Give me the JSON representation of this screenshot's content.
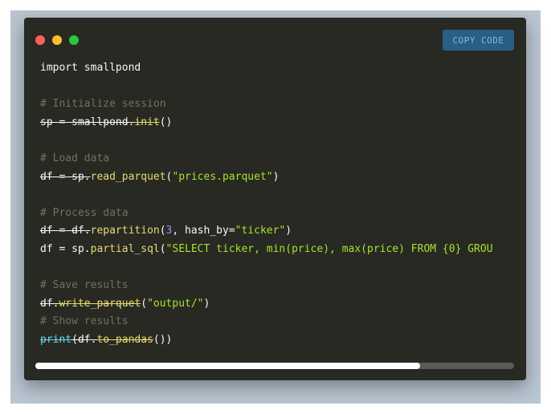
{
  "colors": {
    "close_dot": "#ff5f56",
    "minimize_dot": "#ffbd2e",
    "maximize_dot": "#27c93f",
    "background": "#282923",
    "button_bg": "#2a5f85"
  },
  "window": {
    "copy_button_label": "COPY CODE"
  },
  "code": {
    "language": "python",
    "lines": [
      [
        {
          "t": "import smallpond",
          "c": ""
        }
      ],
      [],
      [
        {
          "t": "# Initialize session",
          "c": "comment"
        }
      ],
      [
        {
          "t": "sp = smallpond.",
          "c": "strike"
        },
        {
          "t": "init",
          "c": "fn strike"
        },
        {
          "t": "()",
          "c": ""
        }
      ],
      [],
      [
        {
          "t": "# Load data",
          "c": "comment"
        }
      ],
      [
        {
          "t": "df = sp.",
          "c": "strike"
        },
        {
          "t": "read_parquet",
          "c": "fn"
        },
        {
          "t": "(",
          "c": ""
        },
        {
          "t": "\"prices.parquet\"",
          "c": "str"
        },
        {
          "t": ")",
          "c": ""
        }
      ],
      [],
      [
        {
          "t": "# Process data",
          "c": "comment"
        }
      ],
      [
        {
          "t": "df = df.",
          "c": "strike"
        },
        {
          "t": "repartition",
          "c": "fn"
        },
        {
          "t": "(",
          "c": ""
        },
        {
          "t": "3",
          "c": "num"
        },
        {
          "t": ", hash_by=",
          "c": ""
        },
        {
          "t": "\"ticker\"",
          "c": "str"
        },
        {
          "t": ")",
          "c": ""
        }
      ],
      [
        {
          "t": "df = sp.",
          "c": ""
        },
        {
          "t": "partial_sql",
          "c": "fn"
        },
        {
          "t": "(",
          "c": ""
        },
        {
          "t": "\"SELECT ticker, min(price), max(price) FROM {0} GROU",
          "c": "str"
        }
      ],
      [],
      [
        {
          "t": "# Save results",
          "c": "comment"
        }
      ],
      [
        {
          "t": "df.",
          "c": "strike"
        },
        {
          "t": "write_parquet",
          "c": "fn strike"
        },
        {
          "t": "(",
          "c": ""
        },
        {
          "t": "\"output/\"",
          "c": "str"
        },
        {
          "t": ")",
          "c": ""
        }
      ],
      [
        {
          "t": "# Show results",
          "c": "comment"
        }
      ],
      [
        {
          "t": "print",
          "c": "builtin strike"
        },
        {
          "t": "(df.",
          "c": "strike"
        },
        {
          "t": "to_pandas",
          "c": "fn strike"
        },
        {
          "t": "())",
          "c": ""
        }
      ]
    ]
  },
  "scrollbar": {
    "thumb_fraction": 0.804
  }
}
